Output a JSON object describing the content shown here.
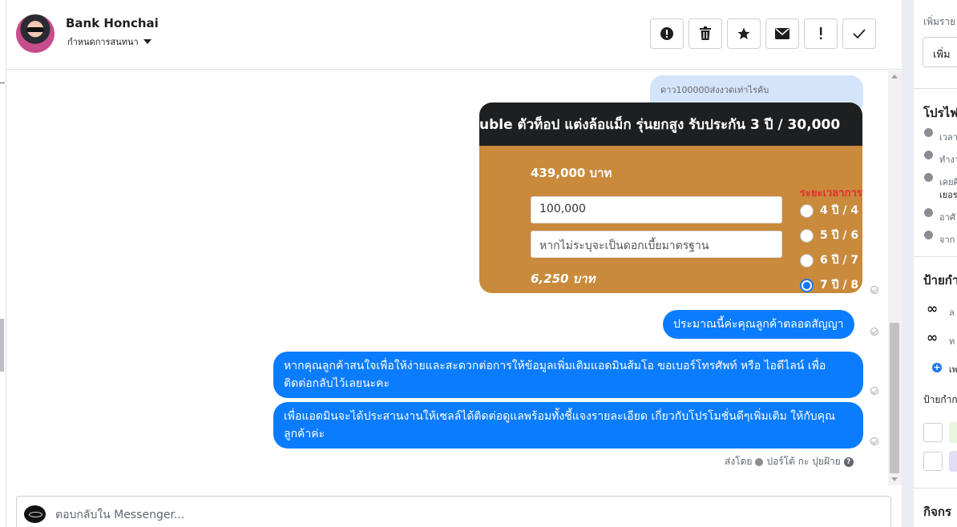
{
  "header": {
    "contact_name": "Bank Honchai",
    "assign_label": "กำหนดการสนทนา",
    "actions": [
      {
        "icon": "spam-icon",
        "glyph": "!"
      },
      {
        "icon": "trash-icon",
        "glyph": "🗑"
      },
      {
        "icon": "star-icon",
        "glyph": "★"
      },
      {
        "icon": "mail-icon",
        "glyph": "✉"
      },
      {
        "icon": "follow-up-icon",
        "glyph": "!"
      },
      {
        "icon": "done-icon",
        "glyph": "✓"
      }
    ]
  },
  "conversation": {
    "reply_preview": "ดาว100000ส่งงวดเท่าไรคับ",
    "promo_card": {
      "banner": "uble ตัวท็อป แต่งล้อแม็ก รุ่นยกสูง รับประกัน 3 ปี / 30,000",
      "price": "439,000 บาท",
      "down_payment_value": "100,000",
      "interest_placeholder": "หากไม่ระบุจะเป็นดอกเบี้ยมาตรฐาน",
      "monthly": "6,250 บาท",
      "period_title": "ระยะเวลาการ",
      "periods": [
        "4 ปี / 4",
        "5 ปี / 6",
        "6 ปี / 7",
        "7 ปี / 8"
      ],
      "selected_period_index": 3
    },
    "messages": [
      "ประมาณนี้ค่ะคุณลูกค้าตลอดสัญญา",
      "หากคุณลูกค้าสนใจเพื่อให้ง่ายและสะดวกต่อการให้ข้อมูลเพิ่มเติมแอดมินส้มโอ ขอเบอร์โทรศัพท์ หรือ ไอดีไลน์ เพื่อติดต่อกลับไว้เลยนะคะ",
      "เพื่อแอดมินจะได้ประสานงานให้เซลล์ได้ติดต่อดูแลพร้อมทั้งชี้แจงรายละเอียด เกี่ยวกับโปรโมชั่นดีๆเพิ่มเติม ให้กับคุณลูกค้าค่ะ"
    ],
    "sent_by_label": "ส่งโดย",
    "sent_by_name": "ปอร์โต้ กะ ปุยฝ้าย"
  },
  "composer": {
    "placeholder": "ตอบกลับใน Messenger..."
  },
  "right_panel": {
    "add_details_label": "เพิ่มราย",
    "add_button_label": "เพิ่ม",
    "profile_title": "โปรไฟ",
    "profile_rows": [
      "เวลา",
      "ทำงา",
      "เคยศึ",
      "เยอร",
      "อาศั",
      "จาก"
    ],
    "labels_title": "ป้ายกำ",
    "label_items": [
      "ล",
      "ท"
    ],
    "add_label": "เพ",
    "ad_labels_title": "ป้ายกำก",
    "activity_title": "กิจกร"
  },
  "colors": {
    "bubble": "#0a7cff",
    "reply_bubble": "#d4e4fb",
    "promo_bg": "#c98a3c",
    "promo_bar": "#1e1f20"
  }
}
